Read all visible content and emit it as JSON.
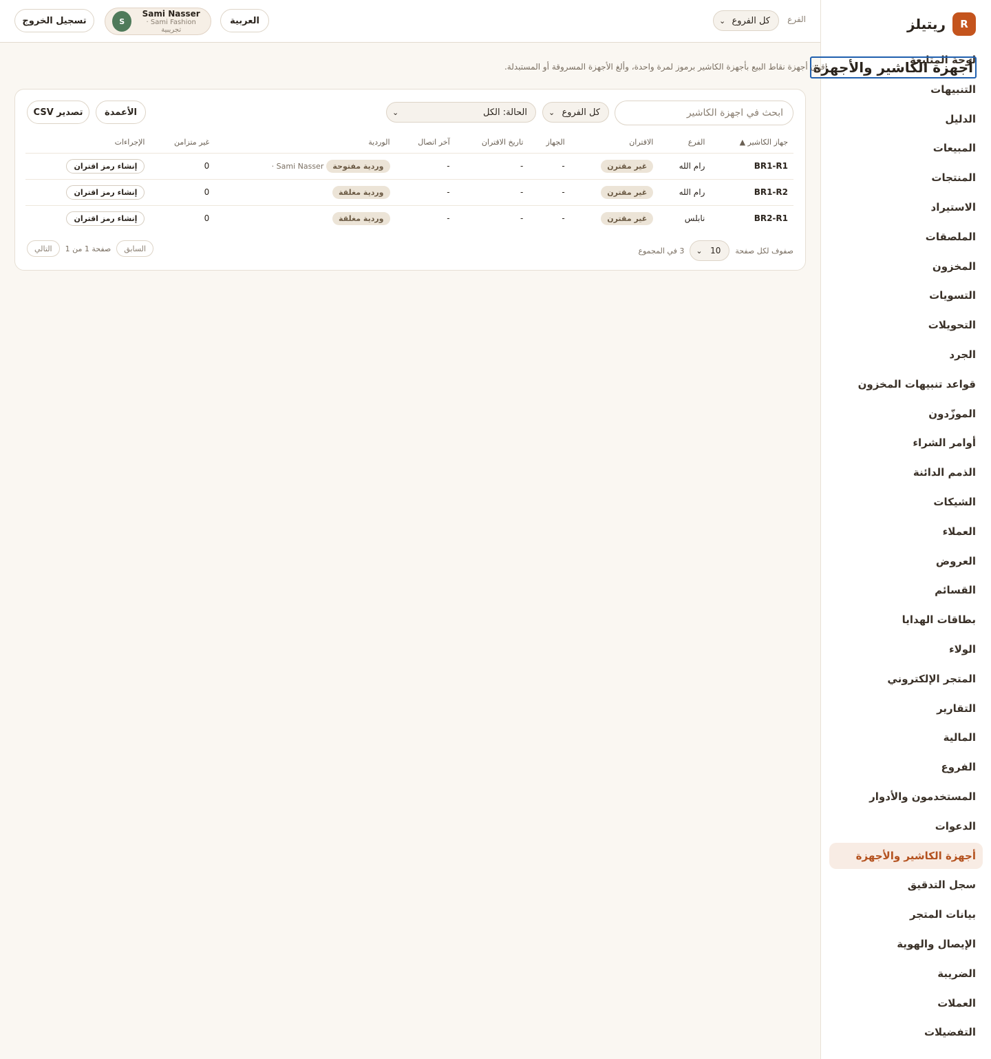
{
  "brand": {
    "logo_letter": "R",
    "name": "ريتيلز",
    "accent": "#c4541d"
  },
  "sidebar": {
    "items": [
      {
        "label": "لوحة المتابعة"
      },
      {
        "label": "التنبيهات"
      },
      {
        "label": "الدليل"
      },
      {
        "label": "المبيعات"
      },
      {
        "label": "المنتجات"
      },
      {
        "label": "الاستيراد"
      },
      {
        "label": "الملصقات"
      },
      {
        "label": "المخزون"
      },
      {
        "label": "التسويات"
      },
      {
        "label": "التحويلات"
      },
      {
        "label": "الجرد"
      },
      {
        "label": "قواعد تنبيهات المخزون"
      },
      {
        "label": "الموزّدون"
      },
      {
        "label": "أوامر الشراء"
      },
      {
        "label": "الذمم الدائنة"
      },
      {
        "label": "الشيكات"
      },
      {
        "label": "العملاء"
      },
      {
        "label": "العروض"
      },
      {
        "label": "القسائم"
      },
      {
        "label": "بطاقات الهدايا"
      },
      {
        "label": "الولاء"
      },
      {
        "label": "المتجر الإلكتروني"
      },
      {
        "label": "التقارير"
      },
      {
        "label": "المالية"
      },
      {
        "label": "الفروع"
      },
      {
        "label": "المستخدمون والأدوار"
      },
      {
        "label": "الدعوات"
      },
      {
        "label": "أجهزة الكاشير والأجهزة",
        "active": true
      },
      {
        "label": "سجل التدقيق"
      },
      {
        "label": "بيانات المتجر"
      },
      {
        "label": "الإيصال والهوية"
      },
      {
        "label": "الضريبة"
      },
      {
        "label": "العملات"
      },
      {
        "label": "التفضيلات"
      }
    ]
  },
  "topbar": {
    "branch_label": "الفرع",
    "branch_value": "كل الفروع",
    "language_label": "العربية",
    "user_initial": "S",
    "user_name": "Sami Nasser",
    "user_sub": "Sami Fashion · تجريبية",
    "logout_label": "تسجيل الخروج"
  },
  "page": {
    "title": "أجهزة الكاشير والأجهزة",
    "description": "اقرن أجهزة نقاط البيع بأجهزة الكاشير برموز لمرة واحدة، وألغ الأجهزة المسروقة أو المستبدلة."
  },
  "toolbar": {
    "search_placeholder": "ابحث في اجهزة الكاشير",
    "branch_filter": "كل الفروع",
    "status_filter": "الحالة: الكل",
    "columns_label": "الأعمدة",
    "export_label": "تصدير CSV"
  },
  "table": {
    "headers": [
      "جهاز الكاشير ▲",
      "الفرع",
      "الاقتران",
      "الجهاز",
      "تاريخ الاقتران",
      "آخر اتصال",
      "الوردية",
      "غير متزامن",
      "الإجراءات"
    ],
    "rows": [
      {
        "register": "BR1-R1",
        "branch": "رام الله",
        "pairing": "غير مقترن",
        "device": "-",
        "paired_at": "-",
        "last_seen": "-",
        "shift": "وردية مفتوحة",
        "shift_user": "Sami Nasser ·",
        "unsynced": "0",
        "action": "إنشاء رمز اقتران"
      },
      {
        "register": "BR1-R2",
        "branch": "رام الله",
        "pairing": "غير مقترن",
        "device": "-",
        "paired_at": "-",
        "last_seen": "-",
        "shift": "وردية مغلقة",
        "shift_user": "",
        "unsynced": "0",
        "action": "إنشاء رمز اقتران"
      },
      {
        "register": "BR2-R1",
        "branch": "نابلس",
        "pairing": "غير مقترن",
        "device": "-",
        "paired_at": "-",
        "last_seen": "-",
        "shift": "وردية مغلقة",
        "shift_user": "",
        "unsynced": "0",
        "action": "إنشاء رمز اقتران"
      }
    ]
  },
  "pagination": {
    "rows_per_page_label": "صفوف لكل صفحة",
    "rows_per_page_value": "10",
    "total_label": "3 في المجموع",
    "page_label": "صفحة 1 من 1",
    "prev_label": "السابق",
    "next_label": "التالي"
  }
}
